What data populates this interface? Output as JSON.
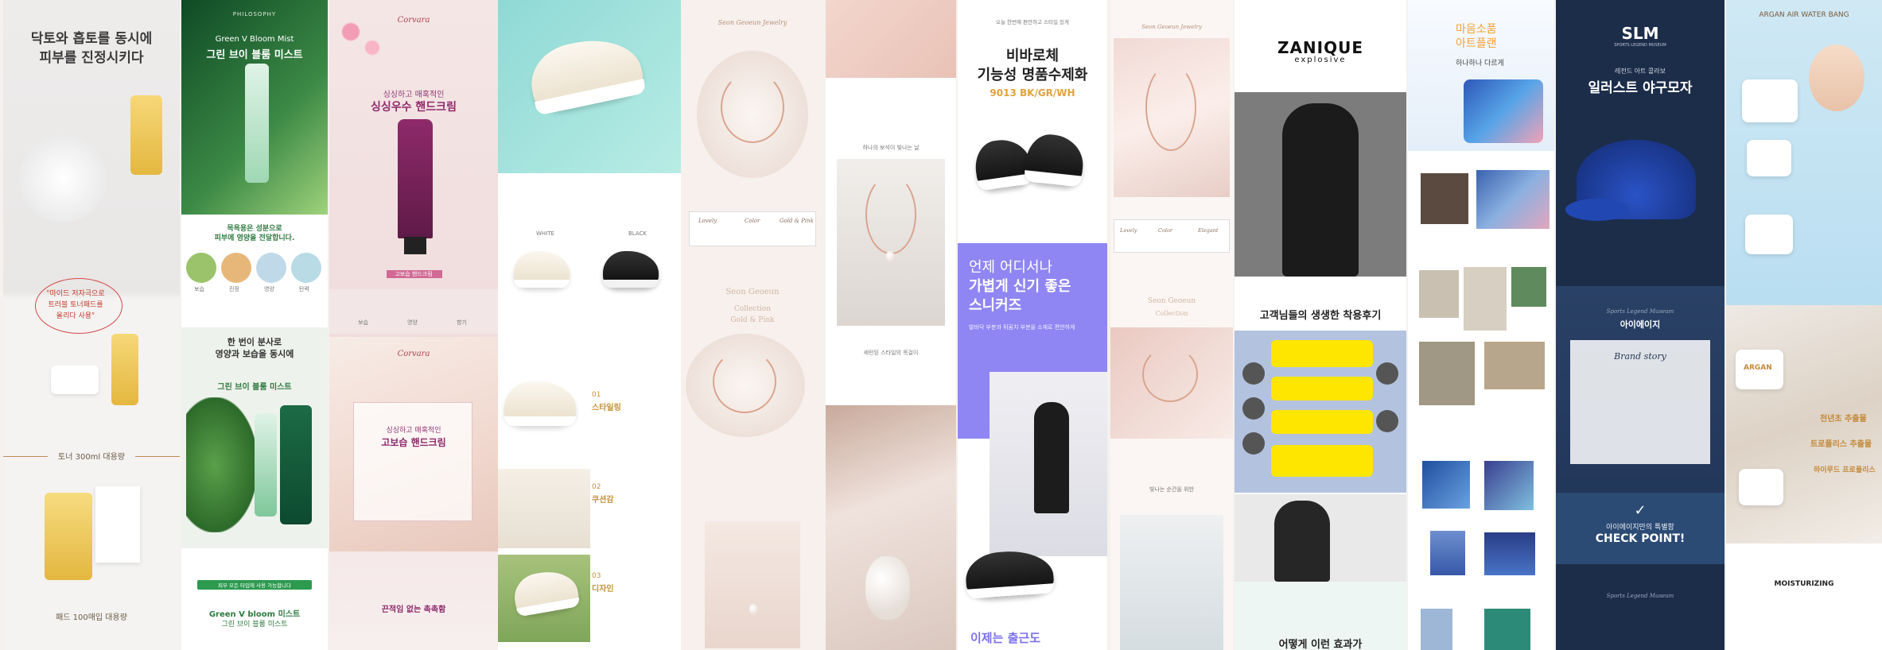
{
  "panels": {
    "p1": {
      "headline1": "닥토와 흡토를 동시에",
      "headline2": "피부를 진정시키다",
      "handwriting1": "\"마이드 저자극으로",
      "handwriting2": "트러블 토너패드를",
      "handwriting3": "올리다 사용\"",
      "volume_label": "토너 300ml 대용량",
      "refill_label": "패드 100매입 대용량"
    },
    "p2": {
      "brand": "PHILOSOPHY",
      "title_en": "Green V Bloom Mist",
      "title_ko": "그린 브이 블룸 미스트",
      "intro1": "목욕용은 성분으로",
      "intro2": "피부에 영양을 전달합니다.",
      "icon_labels": [
        "보습",
        "진정",
        "영양",
        "탄력"
      ],
      "section_title1": "한 번이 분사로",
      "section_title2": "영양과 보습을 동시에",
      "product_name": "그린 브이 블룸 미스트",
      "cta_badge": "피부 모든 타입에 사용 가능합니다",
      "bottom_en": "Green V bloom 미스트",
      "bottom_ko": "그린 브이 블룸 미스트"
    },
    "p3": {
      "brand_top": "Corvara",
      "subtitle": "싱싱하고 매혹적인",
      "title": "싱싱우수 핸드크림",
      "badge": "고보습 핸드크림",
      "icons": [
        "보습",
        "영양",
        "향기"
      ],
      "brand_mid": "Corvara",
      "mid_subtitle": "싱싱하고 매혹적인",
      "mid_title": "고보습 핸드크림",
      "bottom_title": "끈적임 없는 촉촉함"
    },
    "p4": {
      "labels": [
        "WHITE",
        "BLACK"
      ],
      "feature1_num": "01",
      "feature1_title": "스타일링",
      "feature2_num": "02",
      "feature2_title": "쿠션감",
      "feature3_num": "03",
      "feature3_title": "디자인"
    },
    "p5": {
      "brand_script": "Seon Geoeun Jewelry",
      "options": [
        "Lovely",
        "Color",
        "Gold & Pink"
      ],
      "script_title": "Seon Geoeun",
      "script_line2": "Collection",
      "script_line3": "Gold & Pink"
    },
    "p6": {
      "caption": "하나의 보석이 빛나는 날",
      "caption2": "세련된 스타일의 목걸이"
    },
    "p7": {
      "top_small": "오늘 한번에 편안하고 스타일 있게",
      "title1": "비바로체",
      "title2": "기능성 명품수제화",
      "color_code": "9013 BK/GR/WH",
      "purple_line1": "언제 어디서나",
      "purple_line2": "가볍게 신기 좋은",
      "purple_line3": "스니커즈",
      "purple_body": "발바닥 부분과 뒤꿈치 부분을 소재로 편안하게",
      "bottom_title": "이제는 출근도"
    },
    "p8": {
      "brand_script": "Seon Geoeun Jewelry",
      "options": [
        "Lovely",
        "Color",
        "Elegant"
      ],
      "script_title": "Seon Geoeun",
      "script_line2": "Collection",
      "caption": "빛나는 순간을 위한"
    },
    "p9": {
      "brand": "ZANIQUE",
      "brand_sub": "explosive",
      "reviews_title": "고객님들의 생생한 착용후기",
      "bottom_title": "어떻게 이런 효과가"
    },
    "p10": {
      "title1": "마음소품",
      "title2": "아트플랜",
      "subtitle": "하나하나 다르게"
    },
    "p11": {
      "brand": "SLM",
      "brand_sub": "SPORTS LEGEND MUSEUM",
      "subtitle": "레전드 아트 콜라보",
      "title": "일러스트 야구모자",
      "story_script": "Sports Legend Museum",
      "story_label": "아이에이지",
      "brand_story": "Brand story",
      "check_small": "아이에이지만의 특별함",
      "check_title": "CHECK POINT!",
      "bottom_script": "Sports Legend Museum"
    },
    "p12": {
      "title": "ARGAN AIR WATER BANG",
      "jar_label": "ARGAN",
      "ingredient_title1": "천년초 추출물",
      "ingredient_title2": "트로플리스 추출물",
      "ingredient_title3": "하이루드 프로폴리스",
      "bottom_title": "MOISTURIZING"
    }
  }
}
